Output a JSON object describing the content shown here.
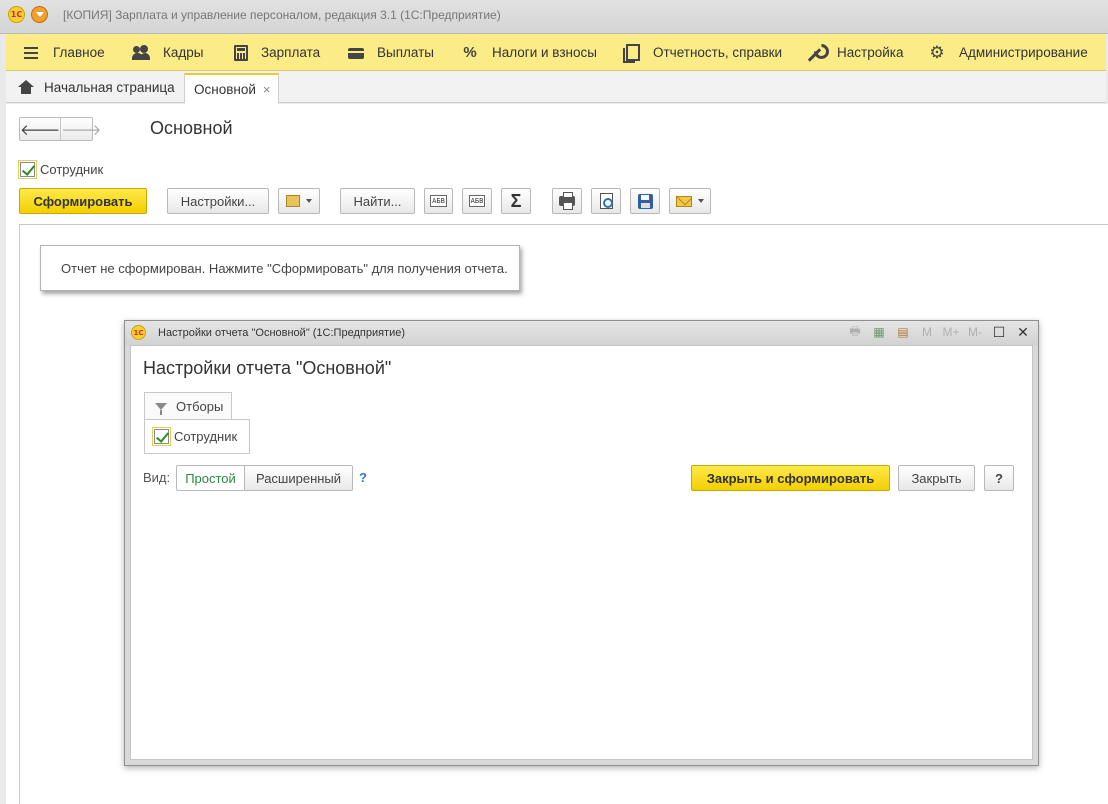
{
  "window": {
    "title": "[КОПИЯ] Зарплата и управление персоналом, редакция 3.1  (1С:Предприятие)",
    "logo": "1С"
  },
  "sections": [
    {
      "icon": "menu-icon",
      "label": "Главное"
    },
    {
      "icon": "people-icon",
      "label": "Кадры"
    },
    {
      "icon": "calculator-icon",
      "label": "Зарплата"
    },
    {
      "icon": "wallet-icon",
      "label": "Выплаты"
    },
    {
      "icon": "percent-icon",
      "label": "Налоги и взносы"
    },
    {
      "icon": "documents-icon",
      "label": "Отчетность, справки"
    },
    {
      "icon": "wrench-icon",
      "label": "Настройка"
    },
    {
      "icon": "gear-icon",
      "label": "Администрирование"
    }
  ],
  "tabs": {
    "home": "Начальная страница",
    "active": "Основной",
    "close_glyph": "×"
  },
  "form": {
    "back_glyph": "🡐",
    "forward_glyph": "🡒",
    "title": "Основной",
    "employee_checkbox_label": "Сотрудник",
    "employee_checked": true
  },
  "toolbar": {
    "generate": "Сформировать",
    "settings": "Настройки...",
    "find": "Найти...",
    "abc1": "АБВ",
    "abc2": "АБВ",
    "sigma": "Σ"
  },
  "notice": "Отчет не сформирован. Нажмите \"Сформировать\" для получения отчета.",
  "dialog": {
    "window_title": "Настройки отчета \"Основной\"  (1С:Предприятие)",
    "logo": "1С",
    "tools": [
      "M",
      "M+",
      "M-"
    ],
    "maximize_glyph": "☐",
    "close_glyph": "✕",
    "heading": "Настройки отчета \"Основной\"",
    "filters_tab": "Отборы",
    "employee_label": "Сотрудник",
    "employee_checked": true,
    "view_label": "Вид:",
    "view_options": [
      "Простой",
      "Расширенный"
    ],
    "view_selected": "Простой",
    "view_help": "?",
    "close_and_generate": "Закрыть и сформировать",
    "close": "Закрыть",
    "help": "?"
  }
}
